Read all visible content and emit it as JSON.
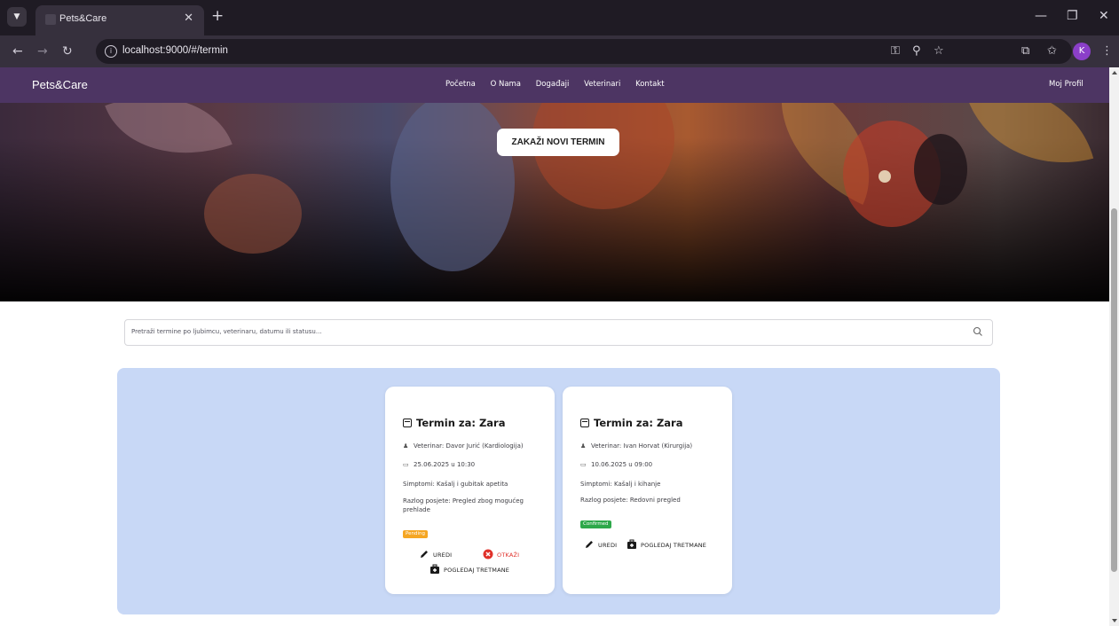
{
  "browser": {
    "tab_title": "Pets&Care",
    "url": "localhost:9000/#/termin",
    "profile_initial": "K"
  },
  "site": {
    "logo": "Pets&Care",
    "nav": [
      "Početna",
      "O Nama",
      "Događaji",
      "Veterinari",
      "Kontakt"
    ],
    "profile_link": "Moj Profil",
    "cta_button": "ZAKAŽI NOVI TERMIN"
  },
  "search": {
    "placeholder": "Pretraži termine po ljubimcu, veterinaru, datumu ili statusu..."
  },
  "appointments": [
    {
      "title": "Termin za: Zara",
      "vet": "Veterinar: Davor Jurić (Kardiologija)",
      "datetime": "25.06.2025 u 10:30",
      "symptoms": "Simptomi: Kašalj i gubitak apetita",
      "reason": "Razlog posjete: Pregled zbog mogućeg prehlade",
      "status": "Pending",
      "actions": {
        "edit": "UREDI",
        "cancel": "OTKAŽI",
        "treatments": "POGLEDAJ TRETMANE"
      }
    },
    {
      "title": "Termin za: Zara",
      "vet": "Veterinar: Ivan Horvat (Kirurgija)",
      "datetime": "10.06.2025 u 09:00",
      "symptoms": "Simptomi: Kašalj i kihanje",
      "reason": "Razlog posjete: Redovni pregled",
      "status": "Confirmed",
      "actions": {
        "edit": "UREDI",
        "treatments": "POGLEDAJ TRETMANE"
      }
    }
  ],
  "colors": {
    "header": "#4d3563",
    "panel": "#c8d8f6",
    "pending": "#f5a623",
    "confirmed": "#2ea84a",
    "cancel": "#e0312a"
  }
}
